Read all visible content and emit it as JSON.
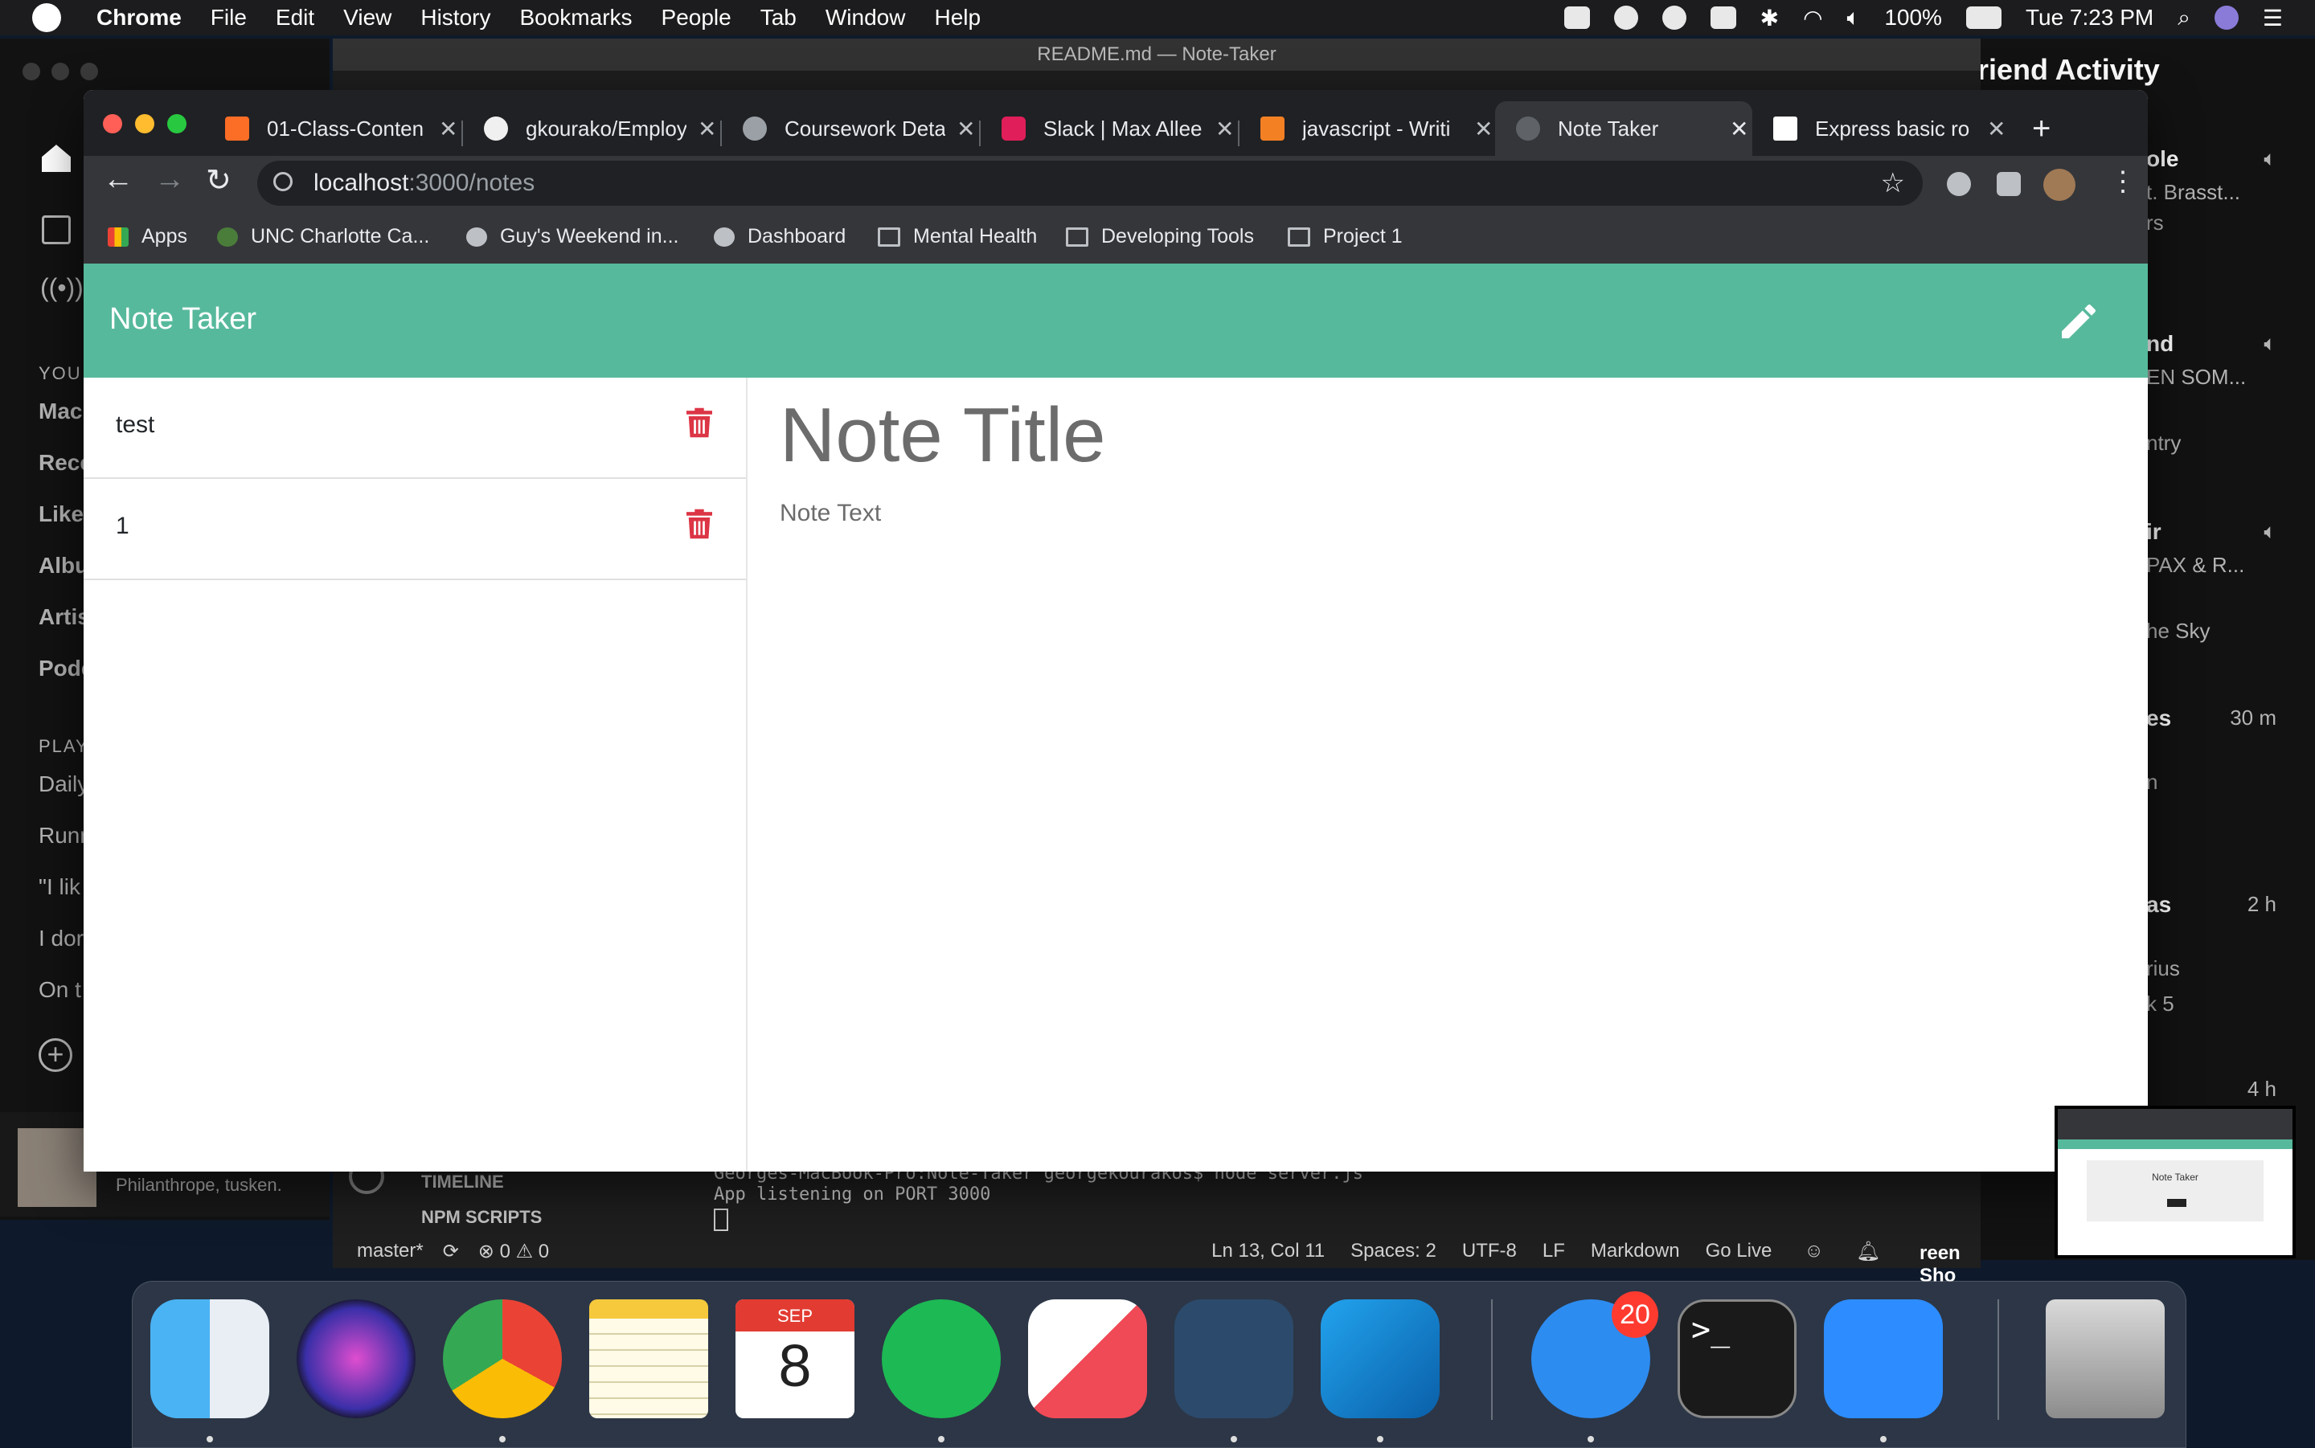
{
  "menubar": {
    "app_name": "Chrome",
    "items": [
      "File",
      "Edit",
      "View",
      "History",
      "Bookmarks",
      "People",
      "Tab",
      "Window",
      "Help"
    ],
    "battery": "100%",
    "clock": "Tue 7:23 PM"
  },
  "spotify": {
    "nav": [
      "Mac",
      "Rece",
      "Like",
      "Albu",
      "Artis",
      "Pode"
    ],
    "section_your": "YOU",
    "section_playlists": "PLAY",
    "playlists": [
      "Daily",
      "Runr",
      "\"I lik",
      "I dor",
      "On t"
    ],
    "now_playing_sub": "Philanthrope, tusken.",
    "friend_header": "riend Activity",
    "friends": [
      {
        "name": "ole",
        "detail": "t. Brasst...",
        "sub": "rs"
      },
      {
        "name": "nd",
        "detail": "EN SOM...",
        "sub": "ntry"
      },
      {
        "name": "ir",
        "detail": "PAX & R...",
        "sub": "he Sky"
      },
      {
        "name": "es",
        "detail": "n",
        "time": "30 m"
      },
      {
        "name": "as",
        "detail": "rius",
        "sub": "k 5",
        "time": "2 h"
      }
    ],
    "last_time": "4 h"
  },
  "vscode": {
    "window_title": "README.md — Note-Taker",
    "sidebar_items": [
      "TIMELINE",
      "NPM SCRIPTS"
    ],
    "terminal_lines": [
      "Georges-MacBook-Pro:Note-Taker georgekourakos$ node server.js",
      "App listening on PORT 3000"
    ],
    "status": {
      "branch": "master*",
      "problems": "⊗ 0 ⚠ 0",
      "position": "Ln 13, Col 11",
      "spaces": "Spaces: 2",
      "encoding": "UTF-8",
      "eol": "LF",
      "language": "Markdown",
      "golive": "Go Live"
    },
    "bottom_right_text": "reen Sho"
  },
  "chrome": {
    "tabs": [
      {
        "title": "01-Class-Conten",
        "icon": "gitlab-icon"
      },
      {
        "title": "gkourako/Employ",
        "icon": "github-icon"
      },
      {
        "title": "Coursework Deta",
        "icon": "globe-icon"
      },
      {
        "title": "Slack | Max Allee",
        "icon": "slack-icon"
      },
      {
        "title": "javascript - Writi",
        "icon": "stackoverflow-icon"
      },
      {
        "title": "Note Taker",
        "icon": "globe-icon",
        "active": true
      },
      {
        "title": "Express basic ro",
        "icon": "express-icon"
      }
    ],
    "url_host": "localhost",
    "url_path": ":3000/notes",
    "bookmarks": [
      "Apps",
      "UNC Charlotte Ca...",
      "Guy's Weekend in...",
      "Dashboard",
      "Mental Health",
      "Developing Tools",
      "Project 1"
    ]
  },
  "app": {
    "title": "Note Taker",
    "notes": [
      {
        "title": "test"
      },
      {
        "title": "1"
      }
    ],
    "editor": {
      "title_placeholder": "Note Title",
      "text_placeholder": "Note Text"
    },
    "accent_color": "#57b99c",
    "delete_color": "#dc3545"
  },
  "thumbnail": {
    "text": "Note Taker"
  },
  "dock": {
    "apps": [
      "Finder",
      "Siri",
      "Chrome",
      "Notes",
      "Calendar",
      "Spotify",
      "News",
      "MySQL Workbench",
      "VS Code",
      "Messages",
      "Terminal",
      "Zoom",
      "Trash"
    ],
    "calendar_month": "SEP",
    "calendar_day": "8",
    "messages_badge": "20"
  }
}
